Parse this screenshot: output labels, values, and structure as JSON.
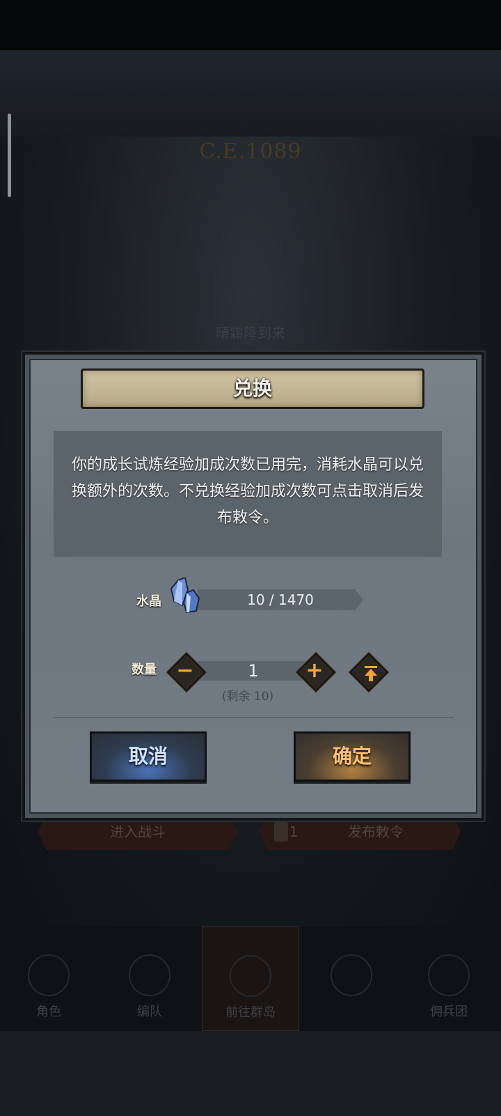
{
  "background": {
    "era_text": "C.E.1089",
    "ghost_label": "晴霜降到来",
    "nav_items": [
      "角色",
      "编队",
      "前往群岛",
      "",
      "佣兵团"
    ],
    "actions": {
      "enter_battle": "进入战斗",
      "publish_order_count": "1",
      "publish_order": "发布敕令"
    }
  },
  "dialog": {
    "title": "兑换",
    "message": "你的成长试炼经验加成次数已用完，消耗水晶可以兑换额外的次数。不兑换经验加成次数可点击取消后发布敕令。",
    "resource": {
      "label": "水晶",
      "icon": "crystal-icon",
      "value": "10 / 1470"
    },
    "quantity": {
      "label": "数量",
      "value": "1",
      "remaining": "(剩余 10)"
    },
    "cancel_label": "取消",
    "confirm_label": "确定"
  },
  "colors": {
    "accent_orange": "#f0a638",
    "cancel_glow": "#4a72b8",
    "confirm_glow": "#b08040"
  }
}
